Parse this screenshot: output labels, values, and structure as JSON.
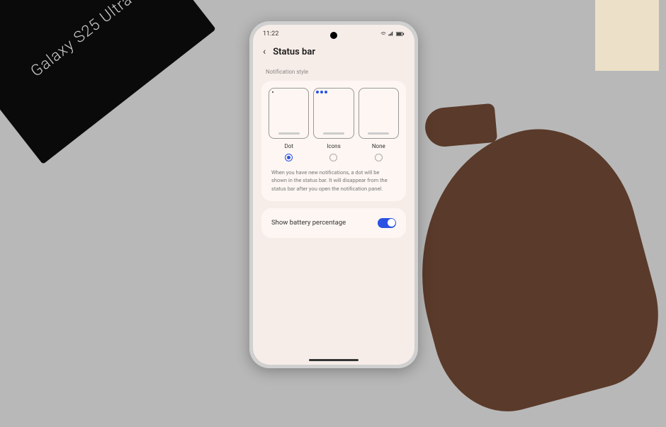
{
  "box_label": "Galaxy S25 Ultra",
  "status": {
    "time": "11:22",
    "icons": "📶 ▮▮ 🔋"
  },
  "header": {
    "back": "‹",
    "title": "Status bar"
  },
  "notification_style": {
    "label": "Notification style",
    "options": [
      {
        "label": "Dot",
        "selected": true
      },
      {
        "label": "Icons",
        "selected": false
      },
      {
        "label": "None",
        "selected": false
      }
    ],
    "description": "When you have new notifications, a dot will be shown in the status bar. It will disappear from the status bar after you open the notification panel."
  },
  "battery": {
    "label": "Show battery percentage",
    "enabled": true
  }
}
